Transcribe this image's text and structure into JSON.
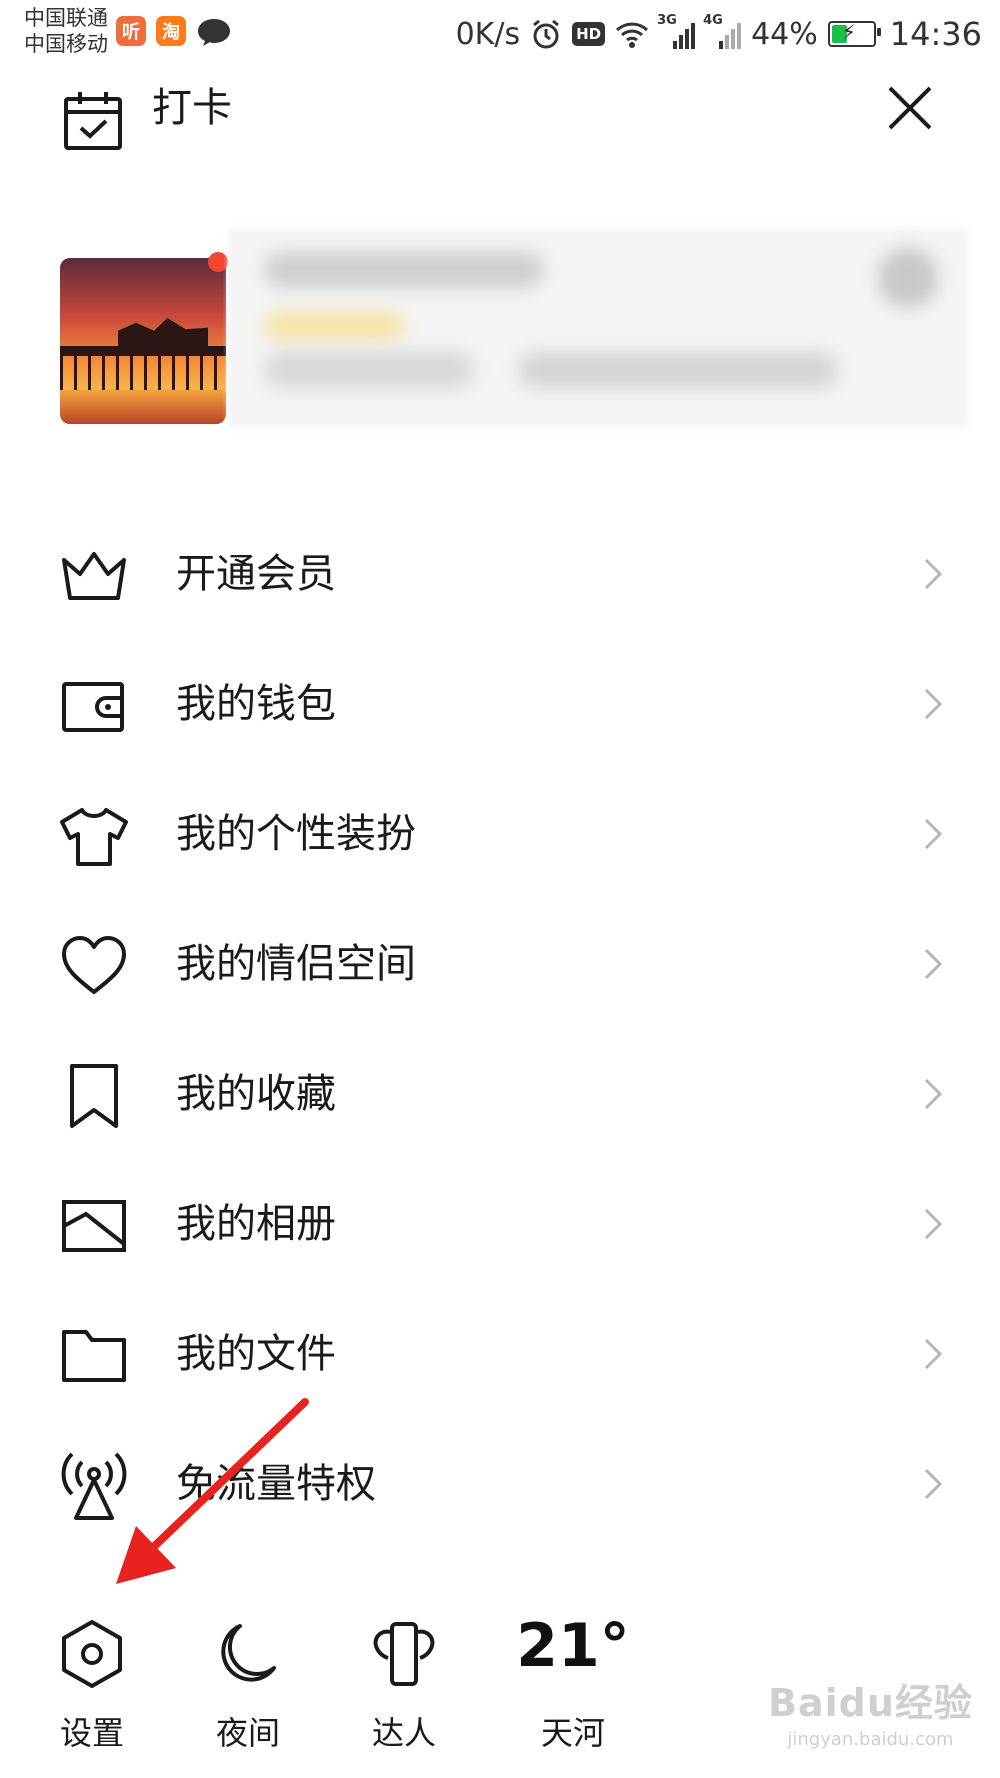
{
  "status_bar": {
    "carrier_1": "中国联通",
    "carrier_2": "中国移动",
    "app_icons": [
      {
        "text": "听",
        "color": "#f26d3d"
      },
      {
        "text": "淘",
        "color": "#ff7a1a"
      }
    ],
    "net_speed": "0K/s",
    "hd_badge": "HD",
    "sim1_net": "3G",
    "sim2_net": "4G",
    "battery_percent": "44%",
    "battery_level": 0.44,
    "time": "14:36"
  },
  "header": {
    "title": "打卡",
    "checkin_icon": "calendar-check-icon",
    "close_icon": "close-icon"
  },
  "menu": [
    {
      "label": "开通会员",
      "icon": "crown-icon"
    },
    {
      "label": "我的钱包",
      "icon": "wallet-icon"
    },
    {
      "label": "我的个性装扮",
      "icon": "tshirt-icon"
    },
    {
      "label": "我的情侣空间",
      "icon": "heart-icon"
    },
    {
      "label": "我的收藏",
      "icon": "bookmark-icon"
    },
    {
      "label": "我的相册",
      "icon": "photo-album-icon"
    },
    {
      "label": "我的文件",
      "icon": "folder-icon"
    },
    {
      "label": "免流量特权",
      "icon": "broadcast-tower-icon"
    }
  ],
  "bottom_bar": {
    "settings": "设置",
    "night": "夜间",
    "expert": "达人",
    "temperature": "21°",
    "location": "天河"
  },
  "watermark": {
    "main": "Baidu经验",
    "sub": "jingyan.baidu.com"
  },
  "colors": {
    "annotation_arrow": "#e8231f",
    "notification_dot": "#f2462f",
    "text": "#1a1a1a"
  }
}
